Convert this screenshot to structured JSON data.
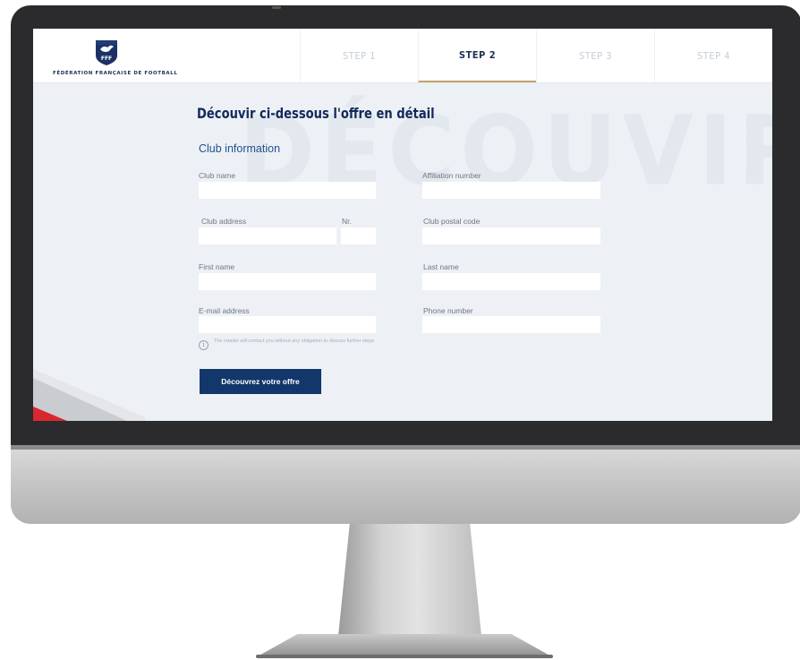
{
  "brand": {
    "name": "FÉDÉRATION FRANÇAISE DE FOOTBALL",
    "monogram": "FFF"
  },
  "steps": [
    {
      "label": "STEP 1",
      "active": false
    },
    {
      "label": "STEP 2",
      "active": true
    },
    {
      "label": "STEP 3",
      "active": false
    },
    {
      "label": "STEP 4",
      "active": false
    }
  ],
  "watermark": "DÉCOUVIR",
  "page": {
    "heading": "Découvir ci-dessous l'offre en détail",
    "section_title": "Club information"
  },
  "form": {
    "club_name": {
      "label": "Club name",
      "value": ""
    },
    "affiliation_number": {
      "label": "Affiliation number",
      "value": ""
    },
    "club_address": {
      "label": "Club address",
      "value": ""
    },
    "address_number": {
      "label": "Nr.",
      "value": ""
    },
    "club_postal_code": {
      "label": "Club postal code",
      "value": ""
    },
    "first_name": {
      "label": "First name",
      "value": ""
    },
    "last_name": {
      "label": "Last name",
      "value": ""
    },
    "email": {
      "label": "E-mail address",
      "value": ""
    },
    "phone": {
      "label": "Phone number",
      "value": ""
    }
  },
  "info_note": "The retailer will contact you without any obligation to discuss further steps",
  "cta_label": "Découvrez votre offre",
  "colors": {
    "navy": "#13295c",
    "button": "#12376b",
    "accent_gold": "#c3a46b",
    "accent_red": "#d8282f",
    "screen_bg": "#edf1f5"
  }
}
